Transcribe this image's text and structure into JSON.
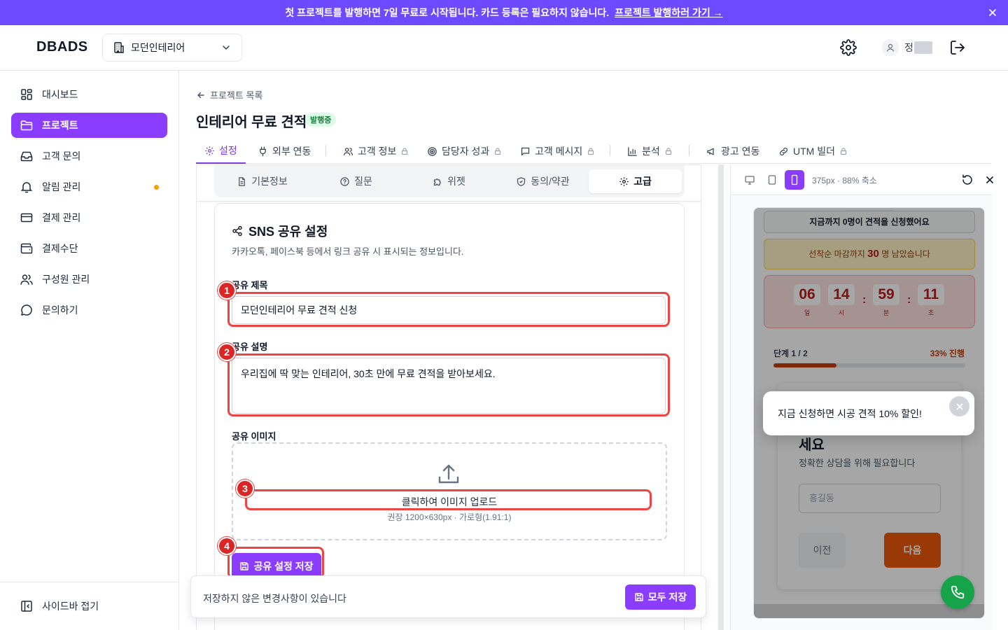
{
  "banner": {
    "text": "첫 프로젝트를 발행하면 7일 무료로 시작됩니다. 카드 등록은 필요하지 않습니다.",
    "cta": "프로젝트 발행하러 가기 →"
  },
  "header": {
    "logo": "DBADS",
    "workspace": "모던인테리어",
    "user_name_visible": "정"
  },
  "sidebar": {
    "items": [
      {
        "label": "대시보드",
        "icon": "dashboard-icon"
      },
      {
        "label": "프로젝트",
        "icon": "folder-icon",
        "active": true
      },
      {
        "label": "고객 문의",
        "icon": "inbox-icon"
      },
      {
        "label": "알림 관리",
        "icon": "bell-icon",
        "badge_dot": true
      },
      {
        "label": "결제 관리",
        "icon": "credit-card-icon"
      },
      {
        "label": "결제수단",
        "icon": "wallet-icon"
      },
      {
        "label": "구성원 관리",
        "icon": "users-icon"
      },
      {
        "label": "문의하기",
        "icon": "chat-icon"
      }
    ],
    "collapse_label": "사이드바 접기"
  },
  "breadcrumb": "프로젝트 목록",
  "project": {
    "title": "인테리어 무료 견적",
    "status": "발행중"
  },
  "tabs": [
    {
      "label": "설정",
      "icon": "gear-icon",
      "active": true
    },
    {
      "label": "외부 연동",
      "icon": "plug-icon"
    },
    {
      "label": "고객 정보",
      "icon": "users-icon",
      "locked": true
    },
    {
      "label": "담당자 성과",
      "icon": "target-icon",
      "locked": true
    },
    {
      "label": "고객 메시지",
      "icon": "message-icon",
      "locked": true
    },
    {
      "label": "분석",
      "icon": "bar-chart-icon",
      "locked": true
    },
    {
      "label": "광고 연동",
      "icon": "megaphone-icon"
    },
    {
      "label": "UTM 빌더",
      "icon": "link-icon",
      "locked": true
    }
  ],
  "subtabs": [
    {
      "label": "기본정보",
      "icon": "file-icon"
    },
    {
      "label": "질문",
      "icon": "help-circle-icon"
    },
    {
      "label": "위젯",
      "icon": "puzzle-icon"
    },
    {
      "label": "동의/약관",
      "icon": "shield-check-icon"
    },
    {
      "label": "고급",
      "icon": "gear-icon",
      "active": true
    }
  ],
  "sns": {
    "title": "SNS 공유 설정",
    "description": "카카오톡, 페이스북 등에서 링크 공유 시 표시되는 정보입니다.",
    "share_title_label": "공유 제목",
    "share_title_value": "모던인테리어 무료 견적 신청",
    "share_desc_label": "공유 설명",
    "share_desc_value": "우리집에 딱 맞는 인테리어, 30초 만에 무료 견적을 받아보세요.",
    "share_image_label": "공유 이미지",
    "upload_text": "클릭하여 이미지 업로드",
    "upload_hint": "권장 1200×630px · 가로형(1.91:1)",
    "save_button": "공유 설정 저장"
  },
  "annotations": [
    "1",
    "2",
    "3",
    "4"
  ],
  "unsaved": {
    "text": "저장하지 않은 변경사항이 있습니다",
    "save_all": "모두 저장"
  },
  "preview": {
    "info": "375px · 88% 축소",
    "count_text": "지금까지 0명이 견적을 신청했어요",
    "deadline_prefix": "선착순 마감까지",
    "deadline_number": "30",
    "deadline_suffix": "명 남았습니다",
    "timer": [
      {
        "value": "06",
        "unit": "일"
      },
      {
        "value": "14",
        "unit": "시"
      },
      {
        "value": "59",
        "unit": "분"
      },
      {
        "value": "11",
        "unit": "초"
      }
    ],
    "step": "단계 1 / 2",
    "progress_label": "33% 진행",
    "progress_fraction": 0.33,
    "form_title": "세요",
    "form_desc": "정확한 상담을 위해 필요합니다",
    "name_placeholder": "홍길동",
    "prev_button": "이전",
    "next_button": "다음",
    "popup_text": "지금 신청하면 시공 견적 10% 할인!"
  },
  "colors": {
    "accent": "#8b3dff",
    "banner": "#6d4aff",
    "annotation": "#ef4444",
    "status_green": "#15803d",
    "cta_orange": "#ea580c"
  }
}
